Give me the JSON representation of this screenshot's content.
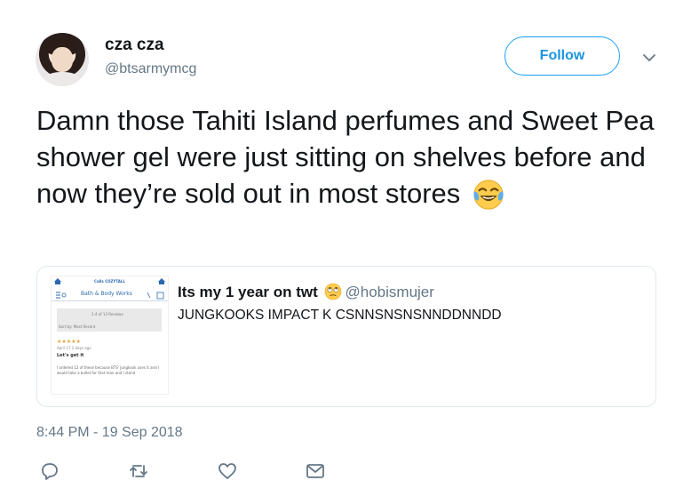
{
  "tweet": {
    "display_name": "cza cza",
    "username": "@btsarmymcg",
    "follow_label": "Follow",
    "text": "Damn those Tahiti Island perfumes and Sweet Pea shower gel were just sitting on shelves before and now they’re sold out in most stores ",
    "emoji": "face-with-tears-of-joy",
    "timestamp": "8:44 PM - 19 Sep 2018"
  },
  "quoted_tweet": {
    "display_name": "Its my 1 year on twt",
    "name_emoji": "face-with-rolling-eyes",
    "username": "@hobismujer",
    "text": "JUNGKOOKS IMPACT K CSNNSNSNSNNDDNNDD",
    "thumbnail": {
      "banner": "Calls COZYTALL",
      "brand": "Bath & Body Works",
      "sort_summary": "1-4 of 13 Reviews",
      "sort_label": "Sort by: Most Recent",
      "stars": "★★★★★",
      "review_meta": "April 17    2 days ago",
      "review_title": "Let's get it",
      "review_body": "I ordered 12 of these because BTS' Jungkook uses it and I would take a bullet for that man and I stand"
    }
  },
  "actions": {
    "reply_icon": "reply-icon",
    "retweet_icon": "retweet-icon",
    "like_icon": "like-icon",
    "dm_icon": "direct-message-icon"
  },
  "colors": {
    "accent": "#1da1f2",
    "secondary_text": "#657786",
    "border": "#e1e8ed"
  }
}
